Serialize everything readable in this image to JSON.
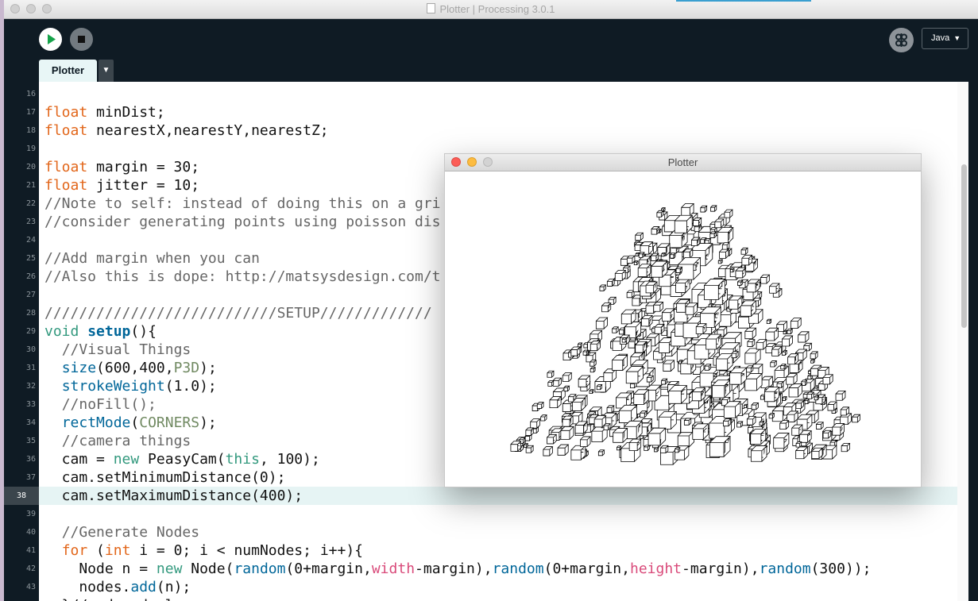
{
  "window": {
    "title": "Plotter | Processing 3.0.1"
  },
  "toolbar": {
    "run_icon": "play-icon",
    "stop_icon": "stop-icon",
    "debug_icon": "debugger-icon",
    "mode": "Java"
  },
  "tabs": [
    {
      "label": "Plotter"
    }
  ],
  "editor": {
    "current_line": "38",
    "lines": [
      {
        "num": "16",
        "html": ""
      },
      {
        "num": "17",
        "html": "<span class='kw'>float</span> minDist;"
      },
      {
        "num": "18",
        "html": "<span class='kw'>float</span> nearestX,nearestY,nearestZ;"
      },
      {
        "num": "19",
        "html": ""
      },
      {
        "num": "20",
        "html": "<span class='kw'>float</span> margin = 30;"
      },
      {
        "num": "21",
        "html": "<span class='kw'>float</span> jitter = 10;"
      },
      {
        "num": "22",
        "html": "<span class='cm'>//Note to self: instead of doing this on a gri</span>"
      },
      {
        "num": "23",
        "html": "<span class='cm'>//consider generating points using poisson dis</span>"
      },
      {
        "num": "24",
        "html": ""
      },
      {
        "num": "25",
        "html": "<span class='cm'>//Add margin when you can</span>"
      },
      {
        "num": "26",
        "html": "<span class='cm'>//Also this is dope: http://matsysdesign.com/t</span>"
      },
      {
        "num": "27",
        "html": ""
      },
      {
        "num": "28",
        "html": "<span class='cm'>///////////////////////////SETUP/////////////</span>"
      },
      {
        "num": "29",
        "html": "<span class='kw2'>void</span> <span class='fnb'>setup</span>(){"
      },
      {
        "num": "30",
        "html": "  <span class='cm'>//Visual Things</span>"
      },
      {
        "num": "31",
        "html": "  <span class='fn'>size</span>(600,400,<span class='const'>P3D</span>);"
      },
      {
        "num": "32",
        "html": "  <span class='fn'>strokeWeight</span>(1.0);"
      },
      {
        "num": "33",
        "html": "  <span class='cm'>//noFill();</span>"
      },
      {
        "num": "34",
        "html": "  <span class='fn'>rectMode</span>(<span class='const'>CORNERS</span>);"
      },
      {
        "num": "35",
        "html": "  <span class='cm'>//camera things</span>"
      },
      {
        "num": "36",
        "html": "  cam = <span class='kw2'>new</span> PeasyCam(<span class='kw2'>this</span>, 100);"
      },
      {
        "num": "37",
        "html": "  cam.setMinimumDistance(0);"
      },
      {
        "num": "38",
        "html": "  cam.setMaximumDistance(400);"
      },
      {
        "num": "39",
        "html": ""
      },
      {
        "num": "40",
        "html": "  <span class='cm'>//Generate Nodes</span>"
      },
      {
        "num": "41",
        "html": "  <span class='kw'>for</span> (<span class='kw'>int</span> i = 0; i &lt; numNodes; i++){"
      },
      {
        "num": "42",
        "html": "    Node n = <span class='kw2'>new</span> Node(<span class='fn'>random</span>(0+margin,<span class='var'>width</span>-margin),<span class='fn'>random</span>(0+margin,<span class='var'>height</span>-margin),<span class='fn'>random</span>(300));"
      },
      {
        "num": "43",
        "html": "    nodes.<span class='fn'>add</span>(n);"
      },
      {
        "num": "",
        "html": "  }//end node loop"
      }
    ]
  },
  "sketch_window": {
    "title": "Plotter"
  }
}
